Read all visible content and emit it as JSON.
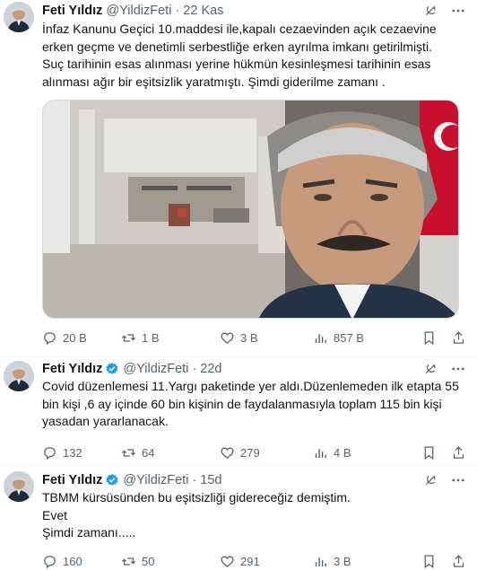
{
  "tweets": [
    {
      "name": "Feti Yıldız",
      "handle": "@YildizFeti",
      "time": "22 Kas",
      "verified": false,
      "text": "İnfaz Kanunu Geçici 10.maddesi ile,kapalı cezaevinden açık cezaevine\nerken geçme ve denetimli serbestliğe erken ayrılma imkanı getirilmişti.\nSuç tarihinin esas alınması yerine hükmün kesinleşmesi tarihinin esas\nalınması ağır bir eşitsizlik yaratmıştı. Şimdi giderilme zamanı .",
      "stats": {
        "replies": "20 B",
        "reposts": "1 B",
        "likes": "3 B",
        "views": "857 B"
      }
    },
    {
      "name": "Feti Yıldız",
      "handle": "@YildizFeti",
      "time": "22d",
      "verified": true,
      "text": "Covid düzenlemesi 11.Yargı paketinde yer aldı.Düzenlemeden ilk etapta 55\nbin kişi ,6 ay içinde 60 bin kişinin de faydalanmasıyla toplam 115 bin kişi\nyasadan yararlanacak.",
      "stats": {
        "replies": "132",
        "reposts": "64",
        "likes": "279",
        "views": "4 B"
      }
    },
    {
      "name": "Feti Yıldız",
      "handle": "@YildizFeti",
      "time": "15d",
      "verified": true,
      "text": "TBMM kürsüsünden bu eşitsizliği gidereceğiz demiştim.\nEvet\nŞimdi zamanı.....",
      "stats": {
        "replies": "160",
        "reposts": "50",
        "likes": "291",
        "views": "3 B"
      }
    }
  ],
  "icons": {
    "header": [
      "grok-icon",
      "more-icon"
    ],
    "actions": [
      "reply-icon",
      "repost-icon",
      "like-icon",
      "views-icon",
      "bookmark-icon",
      "share-icon"
    ]
  },
  "colors": {
    "text": "#0f1419",
    "muted": "#536471",
    "verified": "#1d9bf0",
    "border": "#eff3f4"
  }
}
